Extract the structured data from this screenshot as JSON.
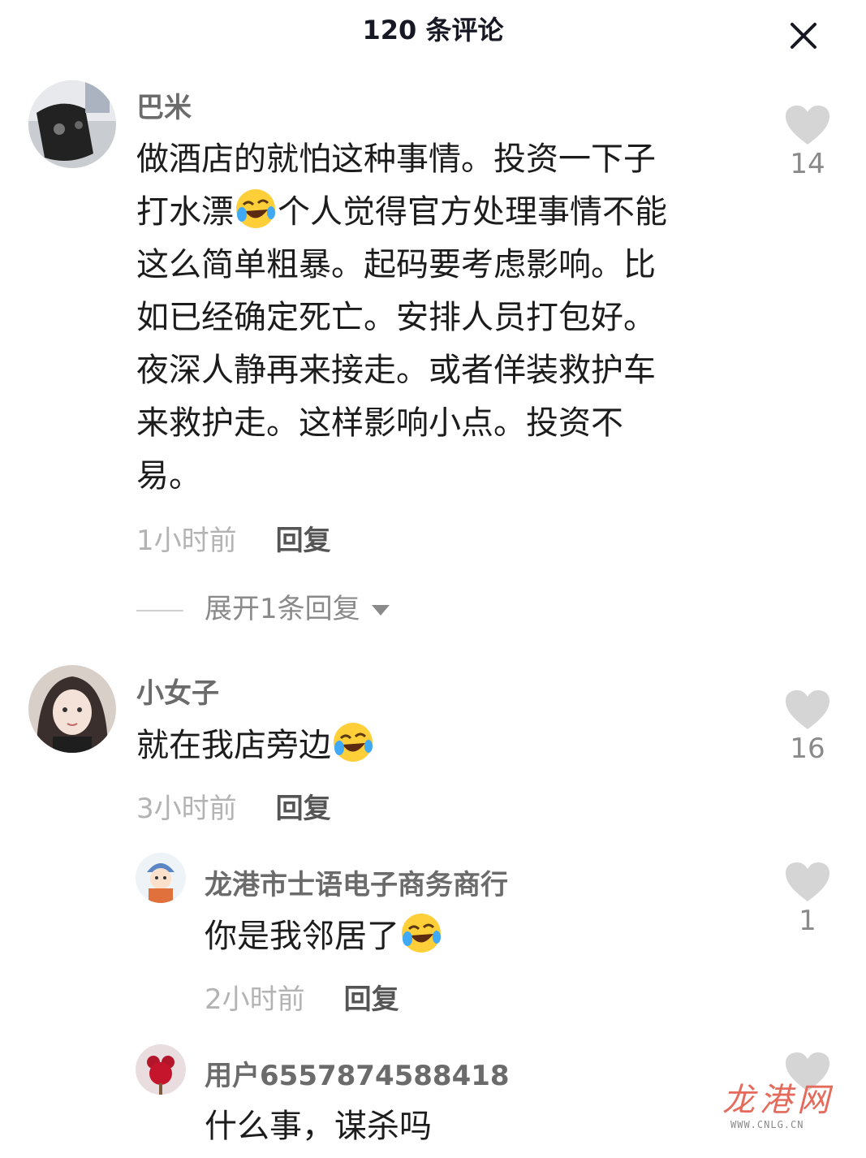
{
  "header": {
    "title": "120 条评论",
    "close_icon": "close-icon"
  },
  "comments": [
    {
      "username": "巴米",
      "text_lines": [
        "做酒店的就怕这种事情。投资一下子",
        "个人觉得官方处理事情不能",
        "这么简单粗暴。起码要考虑影响。比",
        "如已经确定死亡。安排人员打包好。",
        "夜深人静再来接走。或者佯装救护车",
        "来救护走。这样影响小点。投资不",
        "易。"
      ],
      "text_prefix": "打水漂",
      "time": "1小时前",
      "reply_label": "回复",
      "likes": "14",
      "expand_label": "展开1条回复"
    },
    {
      "username": "小女子",
      "text": "就在我店旁边",
      "time": "3小时前",
      "reply_label": "回复",
      "likes": "16"
    },
    {
      "username": "龙港市士语电子商务商行",
      "text": "你是我邻居了",
      "time": "2小时前",
      "reply_label": "回复",
      "likes": "1"
    },
    {
      "username": "用户6557874588418",
      "text": "什么事，谋杀吗"
    }
  ],
  "watermark": {
    "logo": "龙港网",
    "url": "WWW.CNLG.CN"
  },
  "colors": {
    "like_icon": "#d5d5d5",
    "username": "#6b6b6b",
    "time": "#b3b3b3"
  }
}
